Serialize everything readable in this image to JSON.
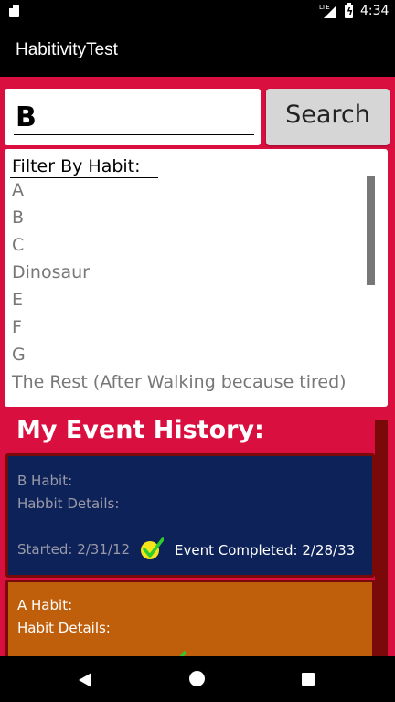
{
  "status_bar": {
    "time": "4:34",
    "network": "LTE",
    "icons": [
      "sd-card-icon",
      "signal-icon",
      "battery-charging-icon"
    ]
  },
  "app": {
    "title": "HabitivityTest"
  },
  "search": {
    "value": "B",
    "button_label": "Search"
  },
  "filter": {
    "heading": "Filter By Habit:",
    "items": [
      "A",
      "B",
      "C",
      "Dinosaur",
      "E",
      "F",
      "G",
      "The Rest (After Walking because tired)"
    ]
  },
  "history": {
    "title": "My Event History:",
    "events": [
      {
        "habit": "B Habit:",
        "details": "Habbit Details:",
        "started": "Started: 2/31/12",
        "completed": "Event Completed: 2/28/33",
        "color": "#0d2258",
        "check_icon": "check-icon"
      },
      {
        "habit": "A Habit:",
        "details": "Habit Details:",
        "color": "#c05f0b",
        "check_icon": "check-icon"
      }
    ]
  },
  "colors": {
    "background": "#d80f3f",
    "app_bar": "#000000",
    "check_yellow": "#f5e51a",
    "check_green": "#2ecc2e"
  },
  "nav_bar": {
    "icons": [
      "back-icon",
      "home-icon",
      "recents-icon"
    ]
  }
}
